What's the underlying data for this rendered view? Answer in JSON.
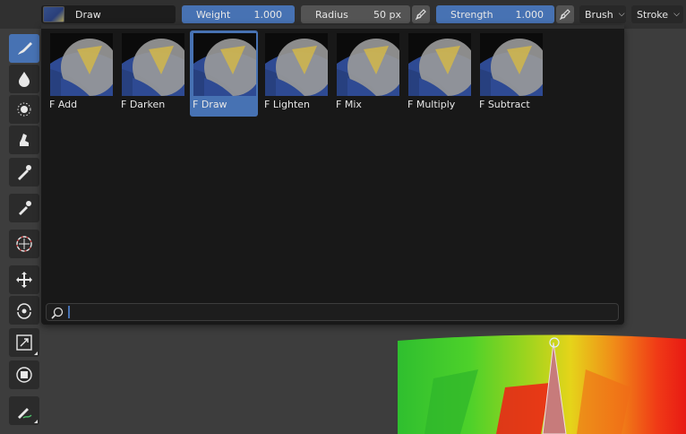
{
  "header": {
    "brush_name": "Draw",
    "weight": {
      "label": "Weight",
      "value": "1.000",
      "fill": 1.0
    },
    "radius": {
      "label": "Radius",
      "value": "50 px"
    },
    "strength": {
      "label": "Strength",
      "value": "1.000",
      "fill": 1.0
    },
    "brush_menu": "Brush",
    "stroke_menu": "Stroke"
  },
  "toolbar": {
    "tools": [
      "draw",
      "blur",
      "average",
      "smear",
      "sample-weight",
      "gradient",
      "cursor",
      "move",
      "rotate",
      "scale",
      "transform",
      "annotate"
    ],
    "active_tool": "draw"
  },
  "popup": {
    "items": [
      {
        "label": "F Add"
      },
      {
        "label": "F Darken"
      },
      {
        "label": "F Draw",
        "selected": true
      },
      {
        "label": "F Lighten"
      },
      {
        "label": "F Mix"
      },
      {
        "label": "F Multiply"
      },
      {
        "label": "F Subtract"
      }
    ],
    "search": {
      "value": "",
      "placeholder": ""
    }
  },
  "colors": {
    "accent": "#4772b3",
    "popup_bg": "#181818",
    "header_bg": "#303030",
    "viewport_bg": "#3d3d3d"
  }
}
